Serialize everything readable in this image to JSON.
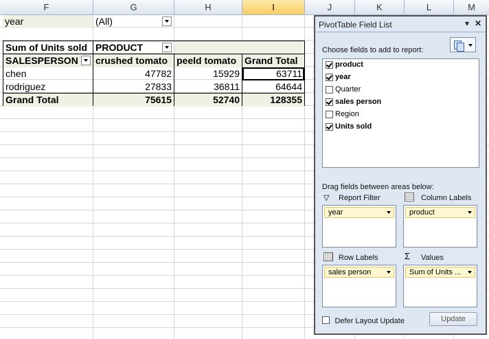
{
  "columns": [
    "F",
    "G",
    "H",
    "I",
    "J",
    "K",
    "L",
    "M"
  ],
  "filter": {
    "label": "year",
    "value": "(All)"
  },
  "pivot": {
    "value_header": "Sum of Units sold",
    "col_field": "PRODUCT",
    "row_field": "SALESPERSON",
    "col_headers": [
      "crushed tomato",
      "peeld tomato",
      "Grand Total"
    ],
    "rows": [
      {
        "name": "chen",
        "values": [
          "47782",
          "15929",
          "63711"
        ]
      },
      {
        "name": "rodriguez",
        "values": [
          "27833",
          "36811",
          "64644"
        ]
      }
    ],
    "total": {
      "name": "Grand Total",
      "values": [
        "75615",
        "52740",
        "128355"
      ]
    }
  },
  "panel": {
    "title": "PivotTable Field List",
    "choose_label": "Choose fields to add to report:",
    "fields": [
      {
        "label": "product",
        "checked": true
      },
      {
        "label": "year",
        "checked": true
      },
      {
        "label": "Quarter",
        "checked": false
      },
      {
        "label": "sales person",
        "checked": true
      },
      {
        "label": "Region",
        "checked": false
      },
      {
        "label": "Units sold",
        "checked": true
      }
    ],
    "drag_label": "Drag fields between areas below:",
    "report_filter_label": "Report Filter",
    "column_labels_label": "Column Labels",
    "row_labels_label": "Row Labels",
    "values_label": "Values",
    "report_filter_chip": "year",
    "column_chip": "product",
    "row_chip": "sales person",
    "values_chip": "Sum of Units ...",
    "defer_label": "Defer Layout Update",
    "update_label": "Update"
  }
}
